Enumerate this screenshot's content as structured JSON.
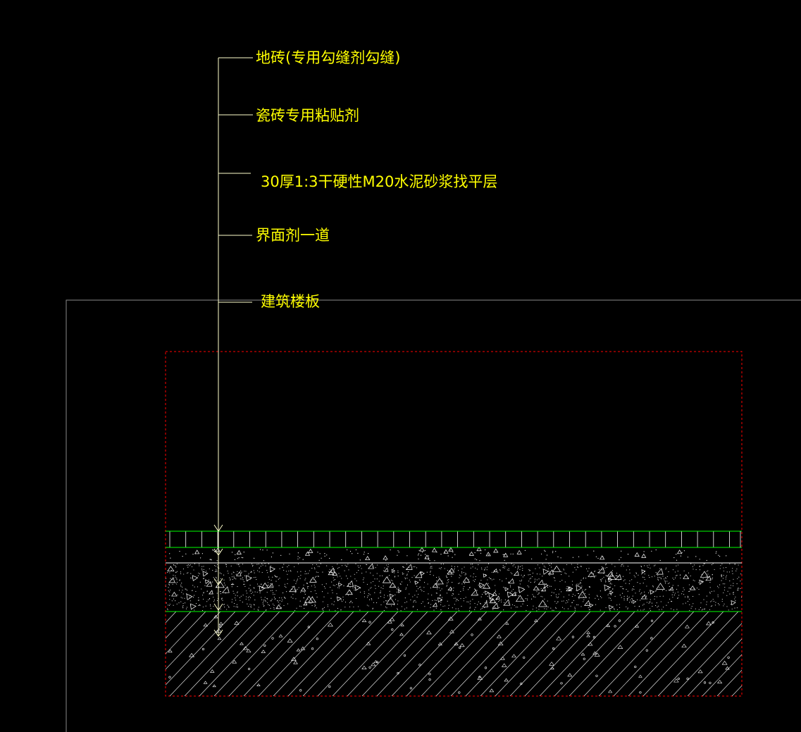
{
  "colors": {
    "background": "#000000",
    "annotation_text": "#ffff00",
    "leader_line": "#ffffcc",
    "frame_line": "#8a8a8a",
    "layer_boundary": "#00ff00",
    "hatch": "#ffffff",
    "extent_box": "#ff0000"
  },
  "layers": [
    {
      "key": "tile",
      "label": "地砖(专用勾缝剂勾缝)",
      "pattern": "tile-grid"
    },
    {
      "key": "adhesive",
      "label": "瓷砖专用粘贴剂",
      "pattern": "thin-dots"
    },
    {
      "key": "screed",
      "label": "30厚1:3干硬性M20水泥砂浆找平层",
      "pattern": "concrete-speckle"
    },
    {
      "key": "interface",
      "label": "界面剂一道",
      "pattern": "line"
    },
    {
      "key": "slab",
      "label": "建筑楼板",
      "pattern": "diagonal-hatch"
    }
  ],
  "icons": {
    "leader_arrow": "arrow-down-icon"
  }
}
